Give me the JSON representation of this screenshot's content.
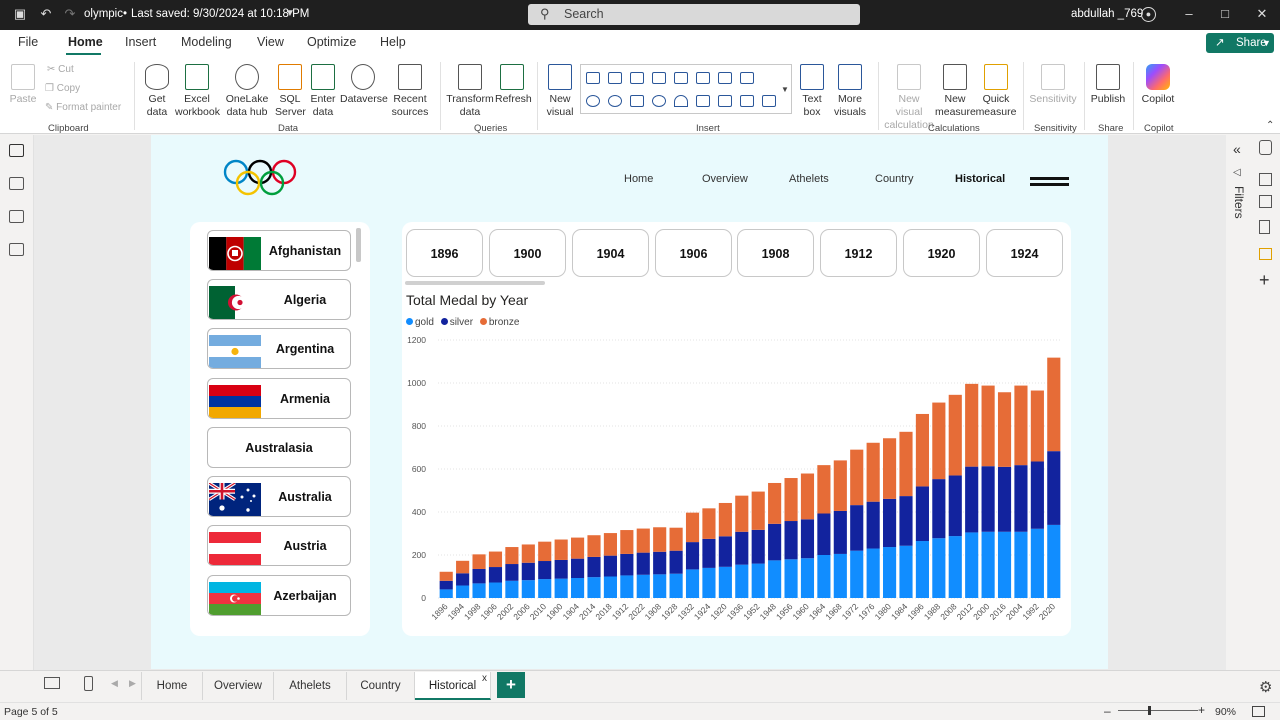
{
  "titlebar": {
    "file_title": "olympic",
    "saved_status": "Last saved: 9/30/2024 at 10:18 PM",
    "search_placeholder": "Search",
    "user": "abdullah _769"
  },
  "menu": [
    "File",
    "Home",
    "Insert",
    "Modeling",
    "View",
    "Optimize",
    "Help"
  ],
  "share_label": "Share",
  "ribbon": {
    "clipboard": {
      "paste": "Paste",
      "cut": "Cut",
      "copy": "Copy",
      "format_painter": "Format painter",
      "label": "Clipboard"
    },
    "data": {
      "get_data": "Get data",
      "excel": "Excel workbook",
      "onelake": "OneLake data hub",
      "sql": "SQL Server",
      "enter": "Enter data",
      "dataverse": "Dataverse",
      "recent": "Recent sources",
      "label": "Data"
    },
    "queries": {
      "transform": "Transform data",
      "refresh": "Refresh",
      "label": "Queries"
    },
    "insert": {
      "new_visual": "New visual",
      "text_box": "Text box",
      "more_visuals": "More visuals",
      "label": "Insert"
    },
    "calculations": {
      "new_visual_calc": "New visual calculation",
      "new_measure": "New measure",
      "quick_measure": "Quick measure",
      "label": "Calculations"
    },
    "sensitivity": {
      "btn": "Sensitivity",
      "label": "Sensitivity"
    },
    "share": {
      "publish": "Publish",
      "label": "Share"
    },
    "copilot": {
      "btn": "Copilot",
      "label": "Copilot"
    }
  },
  "report": {
    "nav": [
      "Home",
      "Overview",
      "Athelets",
      "Country",
      "Historical"
    ],
    "nav_active": "Historical",
    "countries": [
      {
        "name": "Afghanistan",
        "flag": "afghanistan"
      },
      {
        "name": "Algeria",
        "flag": "algeria"
      },
      {
        "name": "Argentina",
        "flag": "argentina"
      },
      {
        "name": "Armenia",
        "flag": "armenia"
      },
      {
        "name": "Australasia",
        "flag": ""
      },
      {
        "name": "Australia",
        "flag": "australia"
      },
      {
        "name": "Austria",
        "flag": "austria"
      },
      {
        "name": "Azerbaijan",
        "flag": "azerbaijan"
      }
    ],
    "year_buttons": [
      "1896",
      "1900",
      "1904",
      "1906",
      "1908",
      "1912",
      "1920",
      "1924"
    ]
  },
  "chart_data": {
    "type": "bar",
    "stacked": true,
    "title": "Total Medal by Year",
    "legend": [
      "gold",
      "silver",
      "bronze"
    ],
    "legend_position": "top-left",
    "colors": {
      "gold": "#118dff",
      "silver": "#12239e",
      "bronze": "#e66c37"
    },
    "ylim": [
      0,
      1200
    ],
    "yticks": [
      0,
      200,
      400,
      600,
      800,
      1000,
      1200
    ],
    "grid": true,
    "categories": [
      "1896",
      "1994",
      "1998",
      "1906",
      "2002",
      "2006",
      "2010",
      "1900",
      "1904",
      "2014",
      "2018",
      "1912",
      "2022",
      "1908",
      "1928",
      "1932",
      "1924",
      "1920",
      "1936",
      "1952",
      "1948",
      "1956",
      "1960",
      "1964",
      "1968",
      "1972",
      "1976",
      "1980",
      "1984",
      "1996",
      "1988",
      "2008",
      "2012",
      "2000",
      "2016",
      "2004",
      "1992",
      "2020"
    ],
    "series": [
      {
        "name": "gold",
        "values": [
          40,
          58,
          68,
          72,
          80,
          83,
          88,
          90,
          93,
          97,
          100,
          105,
          108,
          110,
          113,
          133,
          140,
          145,
          155,
          160,
          175,
          180,
          185,
          200,
          205,
          220,
          230,
          237,
          243,
          265,
          278,
          288,
          305,
          308,
          308,
          308,
          322,
          340
        ]
      },
      {
        "name": "silver",
        "values": [
          40,
          57,
          67,
          72,
          78,
          81,
          84,
          87,
          90,
          94,
          97,
          100,
          103,
          105,
          107,
          127,
          135,
          142,
          153,
          157,
          170,
          178,
          181,
          193,
          200,
          212,
          218,
          224,
          231,
          254,
          275,
          282,
          306,
          305,
          302,
          310,
          313,
          343
        ]
      },
      {
        "name": "bronze",
        "values": [
          42,
          58,
          68,
          72,
          79,
          85,
          90,
          95,
          98,
          101,
          105,
          111,
          112,
          114,
          107,
          137,
          142,
          155,
          168,
          178,
          190,
          200,
          213,
          225,
          235,
          258,
          274,
          282,
          299,
          337,
          356,
          375,
          385,
          375,
          347,
          370,
          330,
          435
        ]
      }
    ]
  },
  "pages": [
    "Home",
    "Overview",
    "Athelets",
    "Country",
    "Historical"
  ],
  "page_active": "Historical",
  "status": {
    "page": "Page 5 of 5",
    "zoom": "90%"
  }
}
